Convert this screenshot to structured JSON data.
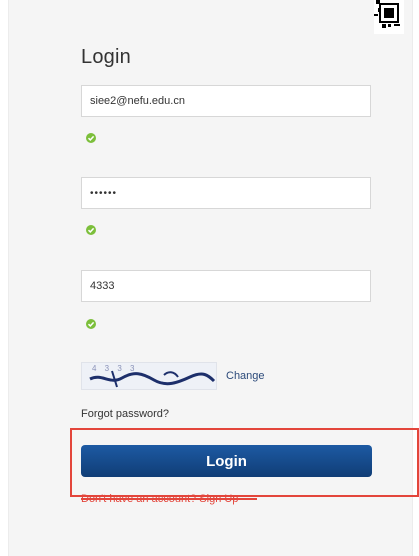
{
  "form": {
    "title": "Login",
    "email_value": "siee2@nefu.edu.cn",
    "password_value": "••••••",
    "captcha_value": "4333",
    "change_label": "Change",
    "forgot_label": "Forgot password?",
    "login_label": "Login",
    "signup_label": "Don't have an account? Sign Up"
  },
  "captcha_image": {
    "text": "4 3 3 3"
  },
  "colors": {
    "button": "#103d76",
    "success": "#7cbf3b",
    "highlight": "#e3453b"
  },
  "icons": {
    "valid": "check-circle-icon",
    "corner": "qr-code-icon"
  }
}
